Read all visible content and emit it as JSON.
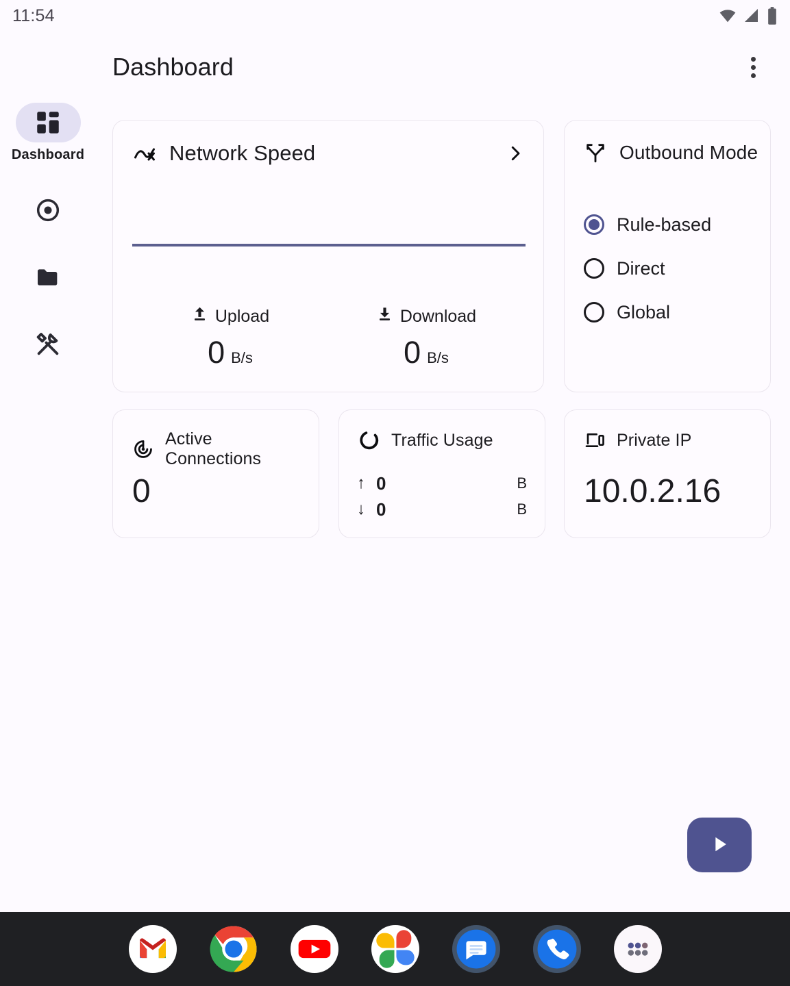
{
  "status_bar": {
    "time": "11:54",
    "icons": [
      "wifi-icon",
      "cell-signal-icon",
      "battery-icon"
    ]
  },
  "app_bar": {
    "title": "Dashboard",
    "overflow_menu": "more-options"
  },
  "nav_rail": {
    "items": [
      {
        "label": "Dashboard",
        "icon": "dashboard-grid-icon",
        "selected": true
      },
      {
        "label": "",
        "icon": "target-icon",
        "selected": false
      },
      {
        "label": "",
        "icon": "folder-icon",
        "selected": false
      },
      {
        "label": "",
        "icon": "tools-icon",
        "selected": false
      }
    ]
  },
  "network_speed": {
    "title": "Network Speed",
    "icon": "activity-line-icon",
    "chevron": "chevron-right-icon",
    "upload": {
      "label": "Upload",
      "icon": "upload-arrow-icon",
      "value": "0",
      "unit": "B/s"
    },
    "download": {
      "label": "Download",
      "icon": "download-arrow-icon",
      "value": "0",
      "unit": "B/s"
    }
  },
  "outbound_mode": {
    "title": "Outbound Mode",
    "icon": "route-split-icon",
    "options": [
      {
        "label": "Rule-based",
        "selected": true
      },
      {
        "label": "Direct",
        "selected": false
      },
      {
        "label": "Global",
        "selected": false
      }
    ]
  },
  "active_connections": {
    "title": "Active Connections",
    "icon": "radar-track-icon",
    "value": "0"
  },
  "traffic_usage": {
    "title": "Traffic Usage",
    "icon": "donut-ring-icon",
    "upload": {
      "arrow": "↑",
      "value": "0",
      "unit": "B"
    },
    "download": {
      "arrow": "↓",
      "value": "0",
      "unit": "B"
    }
  },
  "private_ip": {
    "title": "Private IP",
    "icon": "devices-icon",
    "value": "10.0.2.16"
  },
  "fab": {
    "icon": "play-icon",
    "label": "Start"
  },
  "dock": {
    "apps": [
      {
        "name": "Gmail",
        "icon": "gmail-icon"
      },
      {
        "name": "Chrome",
        "icon": "chrome-icon"
      },
      {
        "name": "YouTube",
        "icon": "youtube-icon"
      },
      {
        "name": "Photos",
        "icon": "google-photos-icon"
      },
      {
        "name": "Messages",
        "icon": "messages-icon"
      },
      {
        "name": "Phone",
        "icon": "phone-icon"
      },
      {
        "name": "All apps",
        "icon": "app-drawer-icon"
      }
    ]
  },
  "chart_data": {
    "type": "line",
    "title": "Network Speed",
    "series": [
      {
        "name": "Upload",
        "values": [
          0,
          0,
          0,
          0,
          0,
          0,
          0,
          0,
          0,
          0
        ]
      },
      {
        "name": "Download",
        "values": [
          0,
          0,
          0,
          0,
          0,
          0,
          0,
          0,
          0,
          0
        ]
      }
    ],
    "x": [
      0,
      1,
      2,
      3,
      4,
      5,
      6,
      7,
      8,
      9
    ],
    "xlabel": "",
    "ylabel": "",
    "ylim": [
      0,
      1
    ],
    "grid": false,
    "legend": "none",
    "line_color": "#5c5f8f"
  },
  "colors": {
    "background": "#fdfaff",
    "card_background": "#fefbff",
    "card_border": "#eae5ee",
    "accent": "#4f5390",
    "nav_pill": "#e3e0f3",
    "text_primary": "#1c1b1f",
    "dock_background": "#1f2023"
  }
}
